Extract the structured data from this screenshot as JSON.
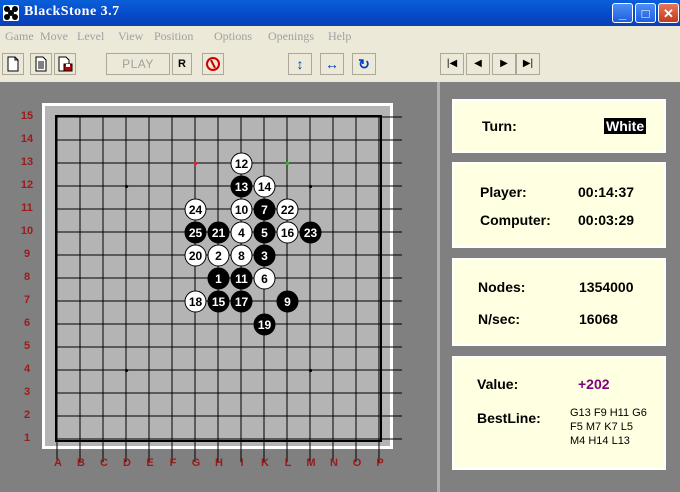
{
  "window": {
    "title": "BlackStone 3.7",
    "min_label": "_",
    "max_label": "□",
    "close_label": "✕"
  },
  "menu": [
    "Game",
    "Move",
    "Level",
    "View",
    "Position",
    "Options",
    "Openings",
    "Help"
  ],
  "toolbar": {
    "new_icon": "new-doc-icon",
    "open_icon": "open-doc-icon",
    "save_icon": "save-disk-icon",
    "play_label": "PLAY",
    "r_label": "R",
    "stop_icon": "stop-icon",
    "flip_v_label": "↕",
    "flip_h_label": "↔",
    "rotate_label": "↻",
    "first_label": "|◀",
    "prev_label": "◀",
    "next_label": "▶",
    "last_label": "▶|"
  },
  "board": {
    "size": 15,
    "columns": [
      "A",
      "B",
      "C",
      "D",
      "E",
      "F",
      "G",
      "H",
      "I",
      "K",
      "L",
      "M",
      "N",
      "O",
      "P"
    ],
    "rows": [
      "15",
      "14",
      "13",
      "12",
      "11",
      "10",
      "9",
      "8",
      "7",
      "6",
      "5",
      "4",
      "3",
      "2",
      "1"
    ],
    "hoshi": [
      [
        "D",
        12
      ],
      [
        "M",
        12
      ],
      [
        "D",
        4
      ],
      [
        "M",
        4
      ]
    ],
    "markers": [
      {
        "col": "G",
        "row": 13,
        "color": "#e02020"
      },
      {
        "col": "L",
        "row": 13,
        "color": "#20c020"
      }
    ],
    "stones": [
      {
        "n": "1",
        "col": "H",
        "row": 8,
        "color": "black"
      },
      {
        "n": "2",
        "col": "H",
        "row": 9,
        "color": "white"
      },
      {
        "n": "3",
        "col": "K",
        "row": 9,
        "color": "black"
      },
      {
        "n": "4",
        "col": "I",
        "row": 10,
        "color": "white"
      },
      {
        "n": "5",
        "col": "K",
        "row": 10,
        "color": "black"
      },
      {
        "n": "6",
        "col": "K",
        "row": 8,
        "color": "white"
      },
      {
        "n": "7",
        "col": "K",
        "row": 11,
        "color": "black"
      },
      {
        "n": "8",
        "col": "I",
        "row": 9,
        "color": "white"
      },
      {
        "n": "9",
        "col": "L",
        "row": 7,
        "color": "black"
      },
      {
        "n": "10",
        "col": "I",
        "row": 11,
        "color": "white"
      },
      {
        "n": "11",
        "col": "I",
        "row": 8,
        "color": "black"
      },
      {
        "n": "12",
        "col": "I",
        "row": 13,
        "color": "white"
      },
      {
        "n": "13",
        "col": "I",
        "row": 12,
        "color": "black"
      },
      {
        "n": "14",
        "col": "K",
        "row": 12,
        "color": "white"
      },
      {
        "n": "15",
        "col": "H",
        "row": 7,
        "color": "black"
      },
      {
        "n": "16",
        "col": "L",
        "row": 10,
        "color": "white"
      },
      {
        "n": "17",
        "col": "I",
        "row": 7,
        "color": "black"
      },
      {
        "n": "18",
        "col": "G",
        "row": 7,
        "color": "white"
      },
      {
        "n": "19",
        "col": "K",
        "row": 6,
        "color": "black"
      },
      {
        "n": "20",
        "col": "G",
        "row": 9,
        "color": "white"
      },
      {
        "n": "21",
        "col": "H",
        "row": 10,
        "color": "black"
      },
      {
        "n": "22",
        "col": "L",
        "row": 11,
        "color": "white"
      },
      {
        "n": "23",
        "col": "M",
        "row": 10,
        "color": "black"
      },
      {
        "n": "24",
        "col": "G",
        "row": 11,
        "color": "white"
      },
      {
        "n": "25",
        "col": "G",
        "row": 10,
        "color": "black"
      }
    ]
  },
  "info": {
    "turn_label": "Turn:",
    "turn_value": "White",
    "player_label": "Player:",
    "player_time": "00:14:37",
    "computer_label": "Computer:",
    "computer_time": "00:03:29",
    "nodes_label": "Nodes:",
    "nodes_value": "1354000",
    "nsec_label": "N/sec:",
    "nsec_value": "16068",
    "value_label": "Value:",
    "value_value": "+202",
    "bestline_label": "BestLine:",
    "bestline_value": "G13 F9 H11 G6 F5 M7 K7 L5 M4 H14 L13"
  }
}
